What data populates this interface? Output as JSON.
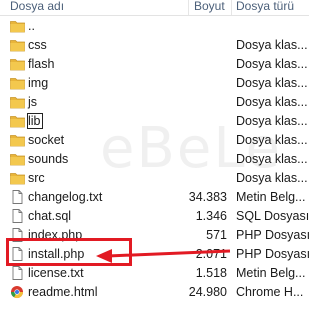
{
  "columns": {
    "name": "Dosya adı",
    "size": "Boyut",
    "type": "Dosya türü"
  },
  "rows": [
    {
      "name": "..",
      "size": "",
      "type": "",
      "icon": "folder-icon"
    },
    {
      "name": "css",
      "size": "",
      "type": "Dosya klas...",
      "icon": "folder-icon"
    },
    {
      "name": "flash",
      "size": "",
      "type": "Dosya klas...",
      "icon": "folder-icon"
    },
    {
      "name": "img",
      "size": "",
      "type": "Dosya klas...",
      "icon": "folder-icon"
    },
    {
      "name": "js",
      "size": "",
      "type": "Dosya klas...",
      "icon": "folder-icon"
    },
    {
      "name": "lib",
      "size": "",
      "type": "Dosya klas...",
      "icon": "folder-icon"
    },
    {
      "name": "socket",
      "size": "",
      "type": "Dosya klas...",
      "icon": "folder-icon"
    },
    {
      "name": "sounds",
      "size": "",
      "type": "Dosya klas...",
      "icon": "folder-icon"
    },
    {
      "name": "src",
      "size": "",
      "type": "Dosya klas...",
      "icon": "folder-icon"
    },
    {
      "name": "changelog.txt",
      "size": "34.383",
      "type": "Metin Belg...",
      "icon": "text-file-icon"
    },
    {
      "name": "chat.sql",
      "size": "1.346",
      "type": "SQL Dosyası",
      "icon": "text-file-icon"
    },
    {
      "name": "index.php",
      "size": "571",
      "type": "PHP Dosyası",
      "icon": "text-file-icon"
    },
    {
      "name": "install.php",
      "size": "2.071",
      "type": "PHP Dosyası",
      "icon": "text-file-icon"
    },
    {
      "name": "license.txt",
      "size": "1.518",
      "type": "Metin Belg...",
      "icon": "text-file-icon"
    },
    {
      "name": "readme.html",
      "size": "24.980",
      "type": "Chrome H...",
      "icon": "chrome-icon"
    }
  ],
  "watermark": "eBeLe",
  "colors": {
    "folder": "#e8b53a",
    "annotation": "#e21a23",
    "header_text": "#4c607a"
  }
}
